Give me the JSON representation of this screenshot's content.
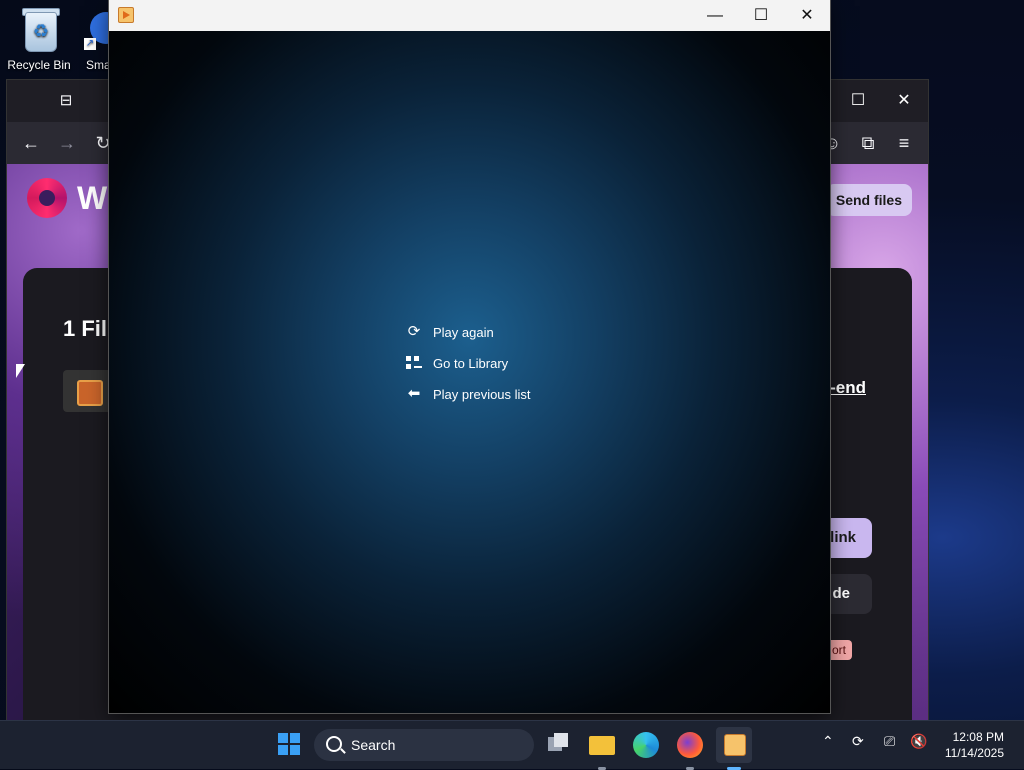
{
  "desktop": {
    "icons": [
      {
        "label": "Recycle Bin"
      },
      {
        "label": "Sma"
      }
    ]
  },
  "browser": {
    "site_logo_text": "W",
    "send_files_label": "Send files",
    "files_heading": "1 Fil",
    "end_link_label": "-end",
    "copy_link_label": "link",
    "code_label": "de",
    "report_label": "ort"
  },
  "player": {
    "menu": [
      {
        "label": "Play again",
        "icon": "replay-icon"
      },
      {
        "label": "Go to Library",
        "icon": "library-grid-icon"
      },
      {
        "label": "Play previous list",
        "icon": "back-arrow-icon"
      }
    ]
  },
  "taskbar": {
    "search_placeholder": "Search",
    "time": "12:08 PM",
    "date": "11/14/2025"
  },
  "colors": {
    "accent": "#3aa0f5",
    "player_glow": "#1c5f8e"
  }
}
